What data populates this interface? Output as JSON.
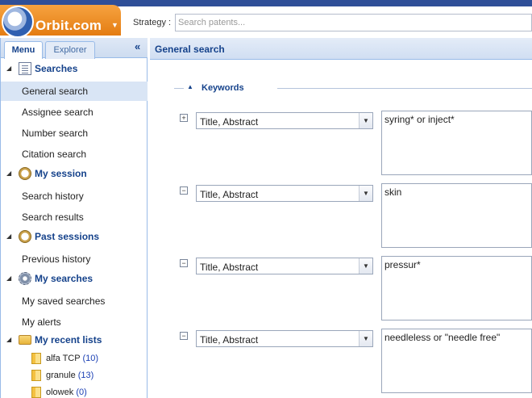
{
  "header": {
    "logo_text": "Orbit.com",
    "strategy_label": "Strategy :",
    "search_placeholder": "Search patents..."
  },
  "left_tabs": {
    "menu": "Menu",
    "explorer": "Explorer",
    "collapse": "«"
  },
  "menu": {
    "searches": {
      "label": "Searches",
      "items": [
        "General search",
        "Assignee search",
        "Number search",
        "Citation search"
      ]
    },
    "my_session": {
      "label": "My session",
      "items": [
        "Search history",
        "Search results"
      ]
    },
    "past_sessions": {
      "label": "Past sessions",
      "items": [
        "Previous history"
      ]
    },
    "my_searches": {
      "label": "My searches",
      "items": [
        "My saved searches",
        "My alerts"
      ]
    },
    "recent_lists": {
      "label": "My recent lists",
      "items": [
        {
          "name": "alfa TCP",
          "count": "(10)"
        },
        {
          "name": "granule",
          "count": "(13)"
        },
        {
          "name": "olowek",
          "count": "(0)"
        }
      ]
    }
  },
  "main": {
    "title": "General search",
    "keywords_label": "Keywords",
    "criteria": [
      {
        "toggle": "+",
        "field": "Title, Abstract",
        "value": "syring* or inject*"
      },
      {
        "toggle": "−",
        "field": "Title, Abstract",
        "value": "skin"
      },
      {
        "toggle": "−",
        "field": "Title, Abstract",
        "value": "pressur*"
      },
      {
        "toggle": "−",
        "field": "Title, Abstract",
        "value": "needleless or \"needle free\""
      }
    ]
  },
  "colors": {
    "accent_blue": "#15428b",
    "logo_orange": "#e47c12",
    "top_band": "#2f4f98",
    "active_row": "#d9e5f5"
  }
}
